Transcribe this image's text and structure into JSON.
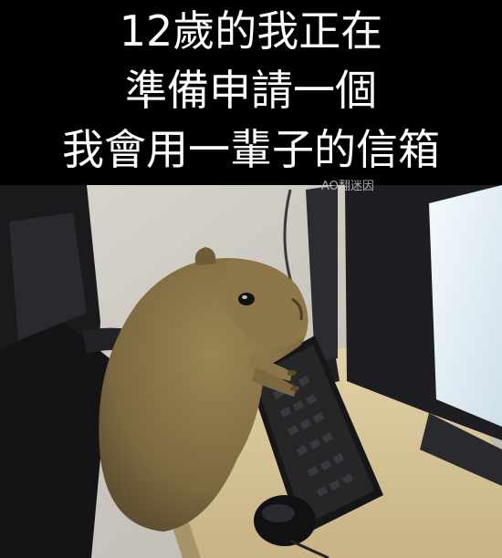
{
  "caption": {
    "line1": "12歲的我正在",
    "line2": "準備申請一個",
    "line3": "我會用一輩子的信箱"
  },
  "watermark": "AO翻迷因",
  "colors": {
    "caption_bg": "#000000",
    "caption_text": "#ffffff",
    "capybara_fur": "#8a7448",
    "desk": "#d8c79a",
    "monitor_screen": "#e8f2f8"
  }
}
